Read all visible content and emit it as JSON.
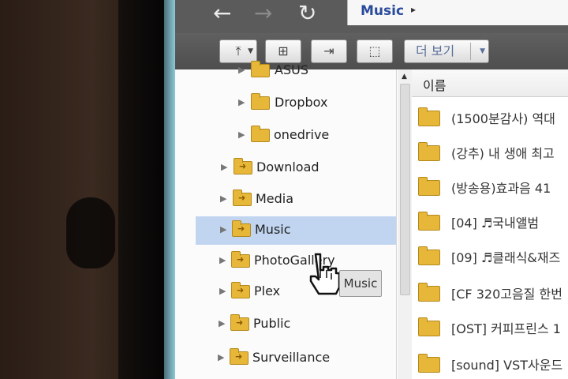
{
  "nav": {
    "back_icon": "back-arrow-icon",
    "forward_icon": "forward-arrow-icon",
    "refresh_icon": "refresh-icon",
    "breadcrumb": "Music",
    "breadcrumb_arrow": "▸"
  },
  "toolbar": {
    "more_label": "더 보기"
  },
  "tree": {
    "items": [
      {
        "label": "ASUS"
      },
      {
        "label": "Dropbox"
      },
      {
        "label": "onedrive"
      },
      {
        "label": "Download"
      },
      {
        "label": "Media"
      },
      {
        "label": "Music",
        "selected": true
      },
      {
        "label": "PhotoGallery"
      },
      {
        "label": "Plex"
      },
      {
        "label": "Public"
      },
      {
        "label": "Surveillance"
      }
    ]
  },
  "list": {
    "header": "이름",
    "items": [
      {
        "name": "(1500분감사) 역대"
      },
      {
        "name": "(강추) 내 생애 최고"
      },
      {
        "name": "(방송용)효과음 41"
      },
      {
        "name": "[04] ♬국내앨범"
      },
      {
        "name": "[09] ♬클래식&재즈"
      },
      {
        "name": "[CF 320고음질 한번"
      },
      {
        "name": "[OST] 커피프린스 1"
      },
      {
        "name": "[sound] VST사운드"
      }
    ]
  },
  "drag": {
    "tooltip": "Music",
    "cursor_icon": "hand-pointer-icon"
  },
  "colors": {
    "selection": "#c1d5f1",
    "folder": "#e6b738",
    "breadcrumb": "#2a4b9c"
  }
}
